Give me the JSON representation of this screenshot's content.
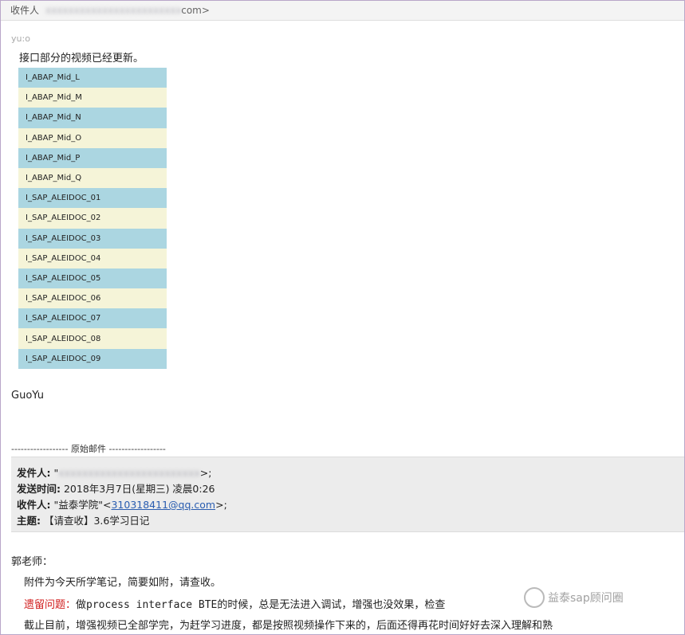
{
  "header": {
    "recipient_label": "收件人",
    "recipient_value": "com>"
  },
  "email": {
    "greeting": "yu:o",
    "intro": "接口部分的视频已经更新。",
    "video_list": [
      "I_ABAP_Mid_L",
      "I_ABAP_Mid_M",
      "I_ABAP_Mid_N",
      "I_ABAP_Mid_O",
      "I_ABAP_Mid_P",
      "I_ABAP_Mid_Q",
      "I_SAP_ALEIDOC_01",
      "I_SAP_ALEIDOC_02",
      "I_SAP_ALEIDOC_03",
      "I_SAP_ALEIDOC_04",
      "I_SAP_ALEIDOC_05",
      "I_SAP_ALEIDOC_06",
      "I_SAP_ALEIDOC_07",
      "I_SAP_ALEIDOC_08",
      "I_SAP_ALEIDOC_09"
    ],
    "signature": "GuoYu"
  },
  "original": {
    "separator": "------------------ 原始邮件 ------------------",
    "from_label": "发件人:",
    "from_value": "\"\";",
    "sent_label": "发送时间:",
    "sent_value": "2018年3月7日(星期三) 凌晨0:26",
    "to_label": "收件人:",
    "to_name": "\"益泰学院\"<",
    "to_email": "310318411@qq.com",
    "to_suffix": ">;",
    "subject_label": "主题:",
    "subject_value": "【请查收】3.6学习日记"
  },
  "message": {
    "salutation": "郭老师：",
    "line1": "附件为今天所学笔记，简要如附，请查收。",
    "line2_label": "遗留问题：",
    "line2_text": "做process interface BTE的时候，总是无法进入调试，增强也没效果，检查",
    "line3": "截止目前，增强视频已全部学完，为赶学习进度，都是按照视频操作下来的，后面还得再花时间好好去深入理解和熟"
  },
  "watermark": {
    "text": "益泰sap顾问圈"
  }
}
